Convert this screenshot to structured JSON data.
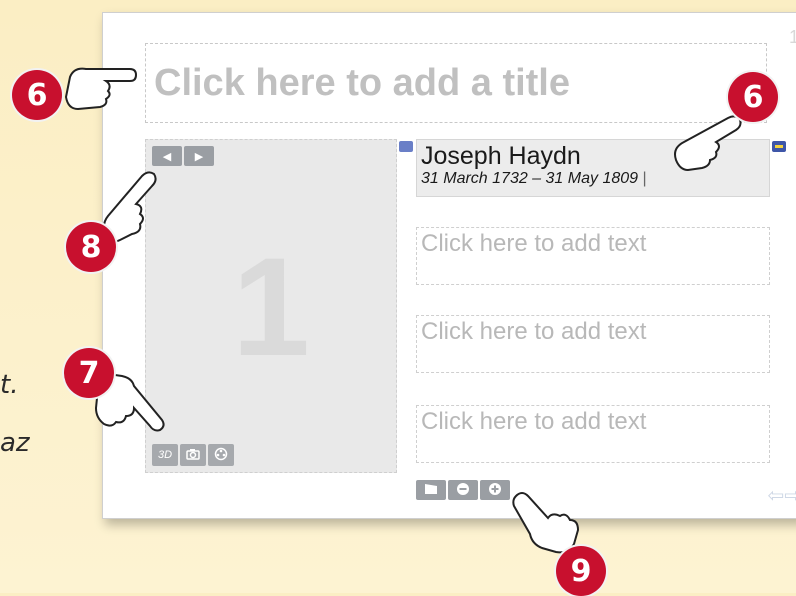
{
  "side_text": {
    "line1": "t.",
    "line2": "az"
  },
  "slide": {
    "number": "1",
    "title_placeholder": "Click here to add a title",
    "panel_number": "1",
    "heading": {
      "name": "Joseph Haydn",
      "dates": "31 March 1732 – 31 May 1809"
    },
    "text_placeholders": [
      "Click here to add text",
      "Click here to add text",
      "Click here to add text"
    ]
  },
  "callouts": [
    "6",
    "6",
    "8",
    "7",
    "9"
  ],
  "icons": {
    "prev": "triangle-left-icon",
    "next": "triangle-right-icon",
    "media": [
      "3d-icon",
      "camera-icon",
      "film-reel-icon"
    ],
    "text_tools": [
      "clapperboard-icon",
      "minus-icon",
      "plus-icon"
    ]
  },
  "colors": {
    "callout": "#c8102e",
    "slide_bg": "#ffffff",
    "panel_bg": "#e9e9e9",
    "button": "#9a9ea3"
  }
}
